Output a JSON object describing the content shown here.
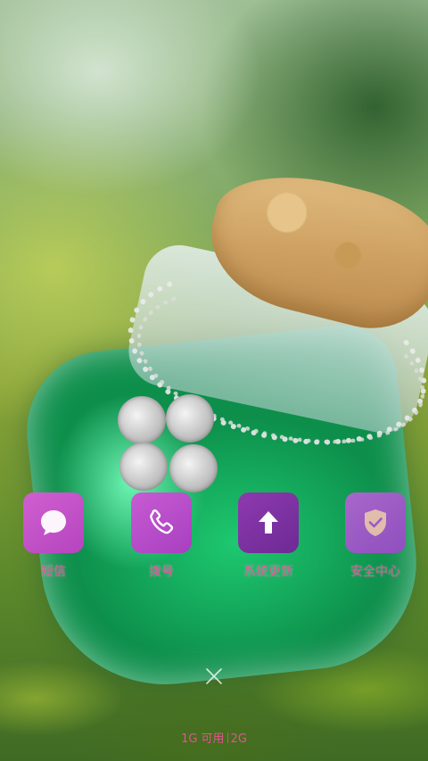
{
  "apps": [
    {
      "label": "短信",
      "icon": "chat-bubble-icon"
    },
    {
      "label": "拨号",
      "icon": "phone-icon"
    },
    {
      "label": "系统更新",
      "icon": "upload-arrow-icon"
    },
    {
      "label": "安全中心",
      "icon": "shield-check-icon"
    }
  ],
  "memory": {
    "available": "1G 可用",
    "total": "2G"
  },
  "close_icon": "close-icon",
  "colors": {
    "label": "#e4559a",
    "sms": "#c454c8",
    "dial": "#b84ecb",
    "update": "#7a2f9f",
    "security": "#9a5ac4"
  }
}
